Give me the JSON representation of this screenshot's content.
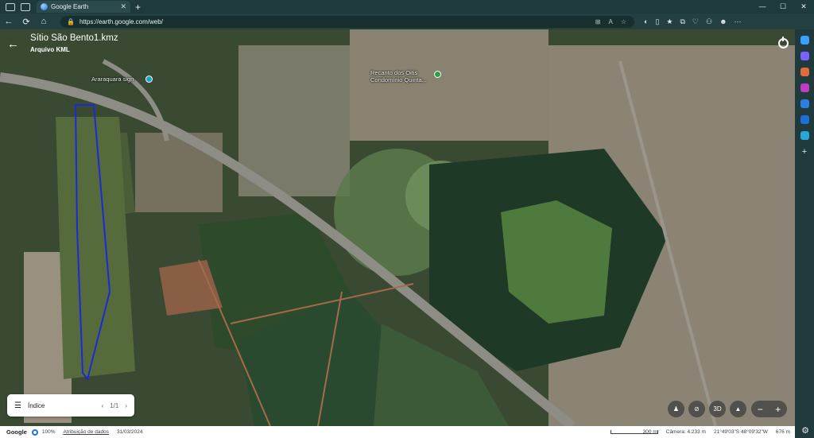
{
  "browser": {
    "tab_title": "Google Earth",
    "url": "https://earth.google.com/web/"
  },
  "header": {
    "title": "Sítio São Bento1.kmz",
    "subtitle": "Arquivo KML"
  },
  "map_labels": {
    "place_1": "Araraquara sign",
    "place_2_line1": "Recanto dos Oitis",
    "place_2_line2": "Condomínio Quinta..."
  },
  "index_panel": {
    "label": "Índice",
    "page": "1/1"
  },
  "controls": {
    "three_d": "3D"
  },
  "status": {
    "brand": "Google",
    "zoom": "100%",
    "attribution": "Atribuição de dados",
    "date": "31/03/2024",
    "scale": "300 m",
    "camera": "Câmera: 4.233 m",
    "coords": "21°49'03\"S 48°09'32\"W",
    "elevation": "676 m"
  },
  "colors": {
    "polygon": "#1a2bd6",
    "accent": "#1a73e8",
    "chrome": "#1f3a3c"
  }
}
